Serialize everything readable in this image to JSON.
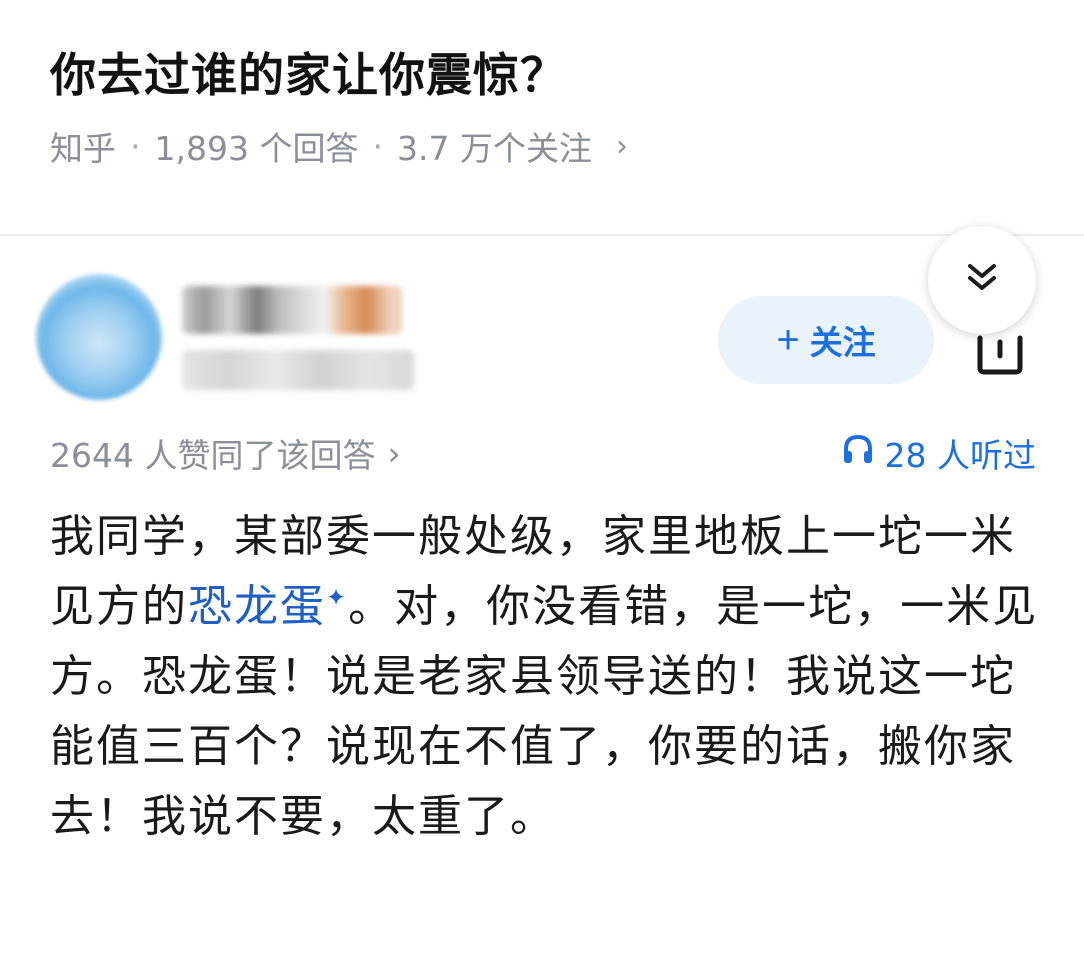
{
  "question": {
    "title": "你去过谁的家让你震惊？",
    "source": "知乎",
    "sep": "·",
    "answers": "1,893 个回答",
    "followers": "3.7 万个关注",
    "chevron": "›"
  },
  "author": {
    "follow_plus": "+",
    "follow_label": "关注",
    "avatar_icon": "avatar-blurred",
    "share_icon": "share-icon",
    "collapse_icon": "double-chevron-down-icon"
  },
  "stats": {
    "votes": "2644 人赞同了该回答",
    "votes_chevron": "›",
    "listeners": "28 人听过",
    "listeners_icon": "headphones-icon"
  },
  "answer": {
    "text_before": "我同学，某部委一般处级，家里地板上一坨一米见方的",
    "link": "恐龙蛋",
    "link_mark": "✦",
    "text_after": "。对，你没看错，是一坨，一米见方。恐龙蛋！说是老家县领导送的！我说这一坨能值三百个？说现在不值了，你要的话，搬你家去！我说不要，太重了。"
  },
  "colors": {
    "accent": "#1d6fe0",
    "meta_gray": "#8a8f99",
    "follow_bg": "#eaf2fc"
  }
}
